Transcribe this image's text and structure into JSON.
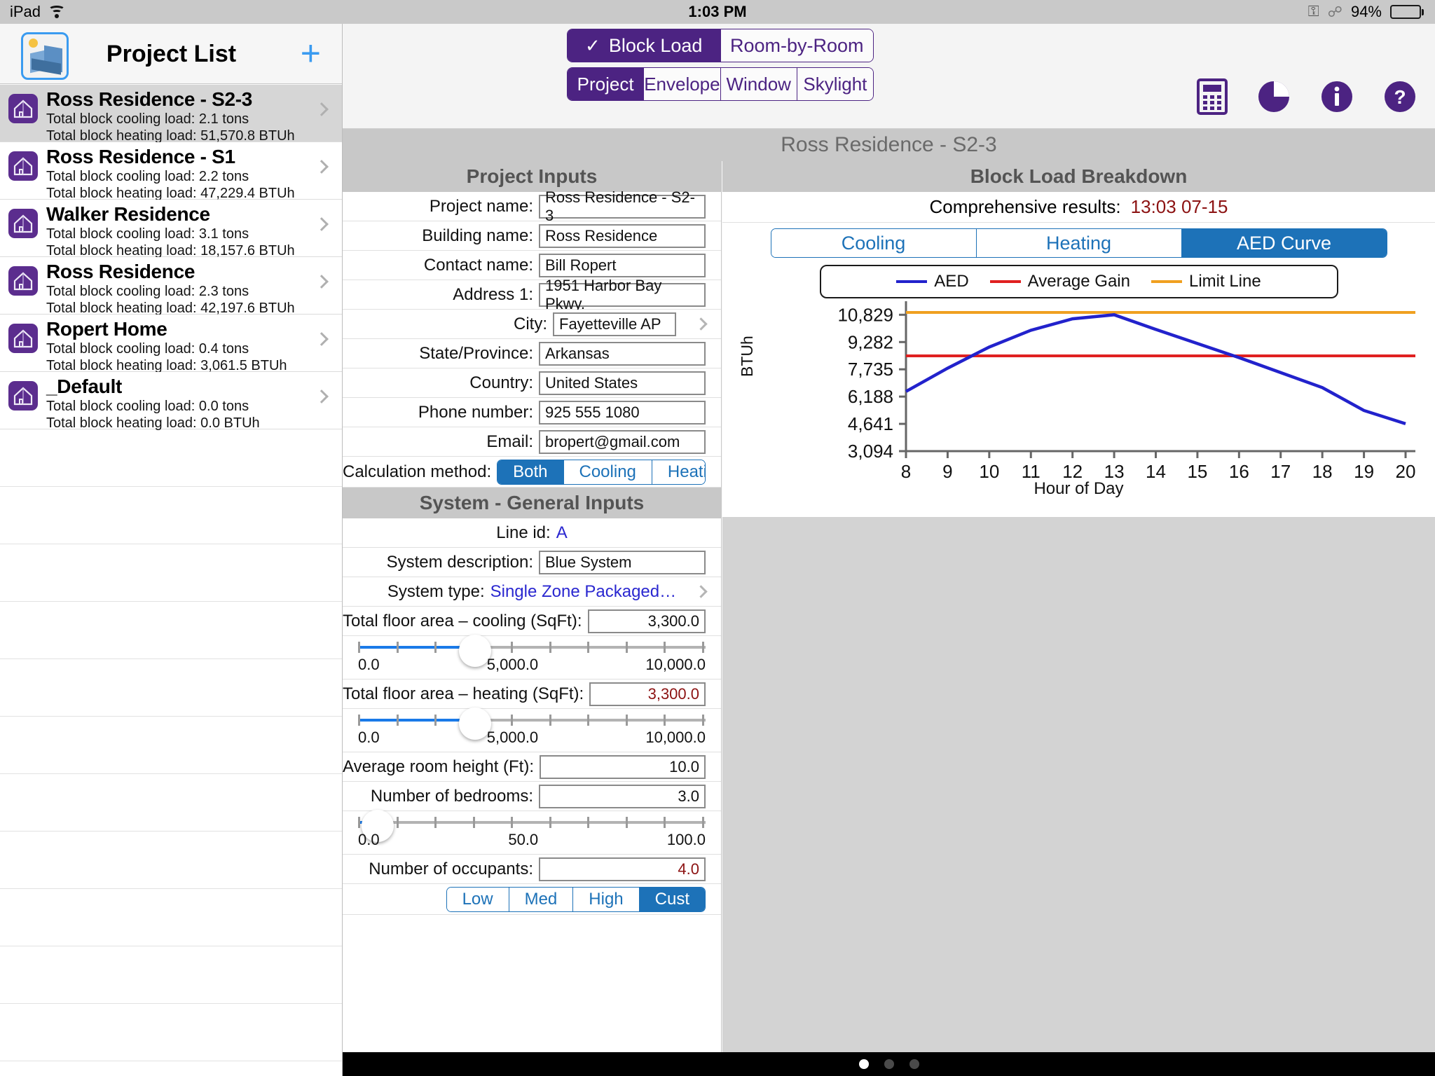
{
  "statusbar": {
    "device": "iPad",
    "wifi_icon": "wifi-icon",
    "time": "1:03 PM",
    "rotation_lock_icon": "rotation-lock-icon",
    "bluetooth_icon": "bluetooth-icon",
    "battery_pct": "94%",
    "battery_icon": "battery-icon"
  },
  "sidebar": {
    "app_icon": "building-blocks-app-icon",
    "title": "Project List",
    "add_label": "+",
    "projects": [
      {
        "name": "Ross Residence - S2-3",
        "cooling": "Total block cooling load: 2.1 tons",
        "heating": "Total block heating load: 51,570.8 BTUh",
        "selected": true
      },
      {
        "name": "Ross Residence - S1",
        "cooling": "Total block cooling load: 2.2 tons",
        "heating": "Total block heating load: 47,229.4 BTUh",
        "selected": false
      },
      {
        "name": "Walker Residence",
        "cooling": "Total block cooling load: 3.1 tons",
        "heating": "Total block heating load: 18,157.6 BTUh",
        "selected": false
      },
      {
        "name": "Ross Residence",
        "cooling": "Total block cooling load: 2.3 tons",
        "heating": "Total block heating load: 42,197.6 BTUh",
        "selected": false
      },
      {
        "name": "Ropert Home",
        "cooling": "Total block cooling load: 0.4 tons",
        "heating": "Total block heating load: 3,061.5 BTUh",
        "selected": false
      },
      {
        "name": "_Default",
        "cooling": "Total block cooling load: 0.0 tons",
        "heating": "Total block heating load: 0.0 BTUh",
        "selected": false
      }
    ]
  },
  "toolbar": {
    "mode_tabs": [
      {
        "label": "Block Load",
        "active": true,
        "check": "✓"
      },
      {
        "label": "Room-by-Room",
        "active": false
      }
    ],
    "section_tabs": [
      {
        "label": "Project",
        "active": true
      },
      {
        "label": "Envelope",
        "active": false
      },
      {
        "label": "Window",
        "active": false
      },
      {
        "label": "Skylight",
        "active": false
      }
    ],
    "icons": [
      {
        "name": "calculator-icon"
      },
      {
        "name": "pie-chart-icon"
      },
      {
        "name": "info-icon"
      },
      {
        "name": "help-icon"
      }
    ],
    "accent_purple": "#4c2382",
    "accent_blue": "#1d72b8"
  },
  "document_title": "Ross Residence - S2-3",
  "project_inputs": {
    "header": "Project Inputs",
    "fields": [
      {
        "label": "Project name:",
        "value": "Ross Residence - S2-3"
      },
      {
        "label": "Building name:",
        "value": "Ross Residence"
      },
      {
        "label": "Contact name:",
        "value": "Bill Ropert"
      },
      {
        "label": "Address 1:",
        "value": "1951 Harbor Bay Pkwy."
      },
      {
        "label": "City:",
        "value": "Fayetteville AP",
        "chevron": true
      },
      {
        "label": "State/Province:",
        "value": "Arkansas"
      },
      {
        "label": "Country:",
        "value": "United States"
      },
      {
        "label": "Phone number:",
        "value": "925 555 1080"
      },
      {
        "label": "Email:",
        "value": "bropert@gmail.com"
      }
    ],
    "calc_method_label": "Calculation method:",
    "calc_method_options": [
      {
        "label": "Both",
        "active": true
      },
      {
        "label": "Cooling",
        "active": false
      },
      {
        "label": "Heating",
        "active": false
      }
    ]
  },
  "system_inputs": {
    "header": "System - General Inputs",
    "line_id_label": "Line id:",
    "line_id_value": "A",
    "description_label": "System description:",
    "description_value": "Blue System",
    "system_type_label": "System type:",
    "system_type_value": "Single Zone Packaged…",
    "floor_cooling_label": "Total floor area – cooling (SqFt):",
    "floor_cooling_value": "3,300.0",
    "floor_cooling_slider": {
      "min": "0.0",
      "mid": "5,000.0",
      "max": "10,000.0",
      "pct": 33
    },
    "floor_heating_label": "Total floor area – heating (SqFt):",
    "floor_heating_value": "3,300.0",
    "floor_heating_slider": {
      "min": "0.0",
      "mid": "5,000.0",
      "max": "10,000.0",
      "pct": 33
    },
    "room_height_label": "Average room height (Ft):",
    "room_height_value": "10.0",
    "bedrooms_label": "Number of bedrooms:",
    "bedrooms_value": "3.0",
    "bedrooms_slider": {
      "min": "0.0",
      "mid": "50.0",
      "max": "100.0",
      "pct": 3
    },
    "occupants_label": "Number of occupants:",
    "occupants_value": "4.0",
    "appliance_options": [
      {
        "label": "Low",
        "active": false
      },
      {
        "label": "Med",
        "active": false
      },
      {
        "label": "High",
        "active": false
      },
      {
        "label": "Cust",
        "active": true
      }
    ]
  },
  "breakdown": {
    "header": "Block Load Breakdown",
    "comprehensive_label": "Comprehensive results:",
    "comprehensive_value": "13:03 07-15",
    "result_tabs": [
      {
        "label": "Cooling",
        "active": false
      },
      {
        "label": "Heating",
        "active": false
      },
      {
        "label": "AED Curve",
        "active": true
      }
    ]
  },
  "chart_data": {
    "type": "line",
    "title": "",
    "xlabel": "Hour of Day",
    "ylabel": "BTUh",
    "x": [
      8,
      9,
      10,
      11,
      12,
      13,
      14,
      15,
      16,
      17,
      18,
      19,
      20
    ],
    "xtick_labels": [
      "8",
      "9",
      "10",
      "11",
      "12",
      "13",
      "14",
      "15",
      "16",
      "17",
      "18",
      "19",
      "20"
    ],
    "ytick_labels": [
      "3,094",
      "4,641",
      "6,188",
      "7,735",
      "9,282",
      "10,829"
    ],
    "ylim": [
      3094,
      11200
    ],
    "xlim": [
      8,
      20
    ],
    "grid": false,
    "legend_position": "top",
    "series": [
      {
        "name": "AED",
        "color": "#2222cc",
        "type": "line",
        "values": [
          6480,
          7800,
          9000,
          9950,
          10600,
          10829,
          10000,
          9200,
          8400,
          7550,
          6700,
          5400,
          4650
        ]
      },
      {
        "name": "Average Gain",
        "color": "#e02020",
        "type": "hline",
        "value": 8500
      },
      {
        "name": "Limit Line",
        "color": "#f0a020",
        "type": "hline",
        "value": 10960
      }
    ]
  }
}
